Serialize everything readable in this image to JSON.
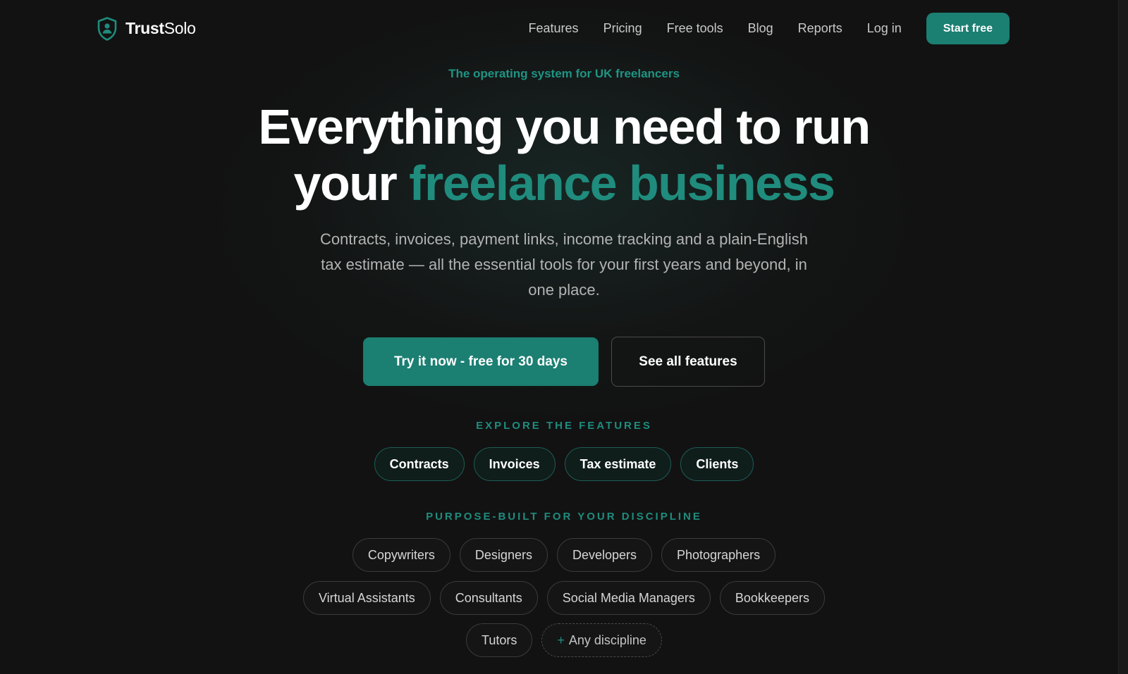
{
  "nav": {
    "brand_bold": "Trust",
    "brand_light": "Solo",
    "links": [
      "Features",
      "Pricing",
      "Free tools",
      "Blog",
      "Reports",
      "Log in"
    ],
    "cta": "Start free"
  },
  "hero": {
    "eyebrow": "The operating system for UK freelancers",
    "headline_line1": "Everything you need to run",
    "headline_line2_plain": "your ",
    "headline_line2_accent": "freelance business",
    "subtitle": "Contracts, invoices, payment links, income tracking and a plain-English tax estimate — all the essential tools for your first years and beyond, in one place.",
    "primary_cta": "Try it now - free for 30 days",
    "secondary_cta": "See all features"
  },
  "features": {
    "label": "EXPLORE THE FEATURES",
    "items": [
      "Contracts",
      "Invoices",
      "Tax estimate",
      "Clients"
    ]
  },
  "disciplines": {
    "label": "PURPOSE-BUILT FOR YOUR DISCIPLINE",
    "row1": [
      "Copywriters",
      "Designers",
      "Developers",
      "Photographers"
    ],
    "row2": [
      "Virtual Assistants",
      "Consultants",
      "Social Media Managers",
      "Bookkeepers"
    ],
    "row3": [
      "Tutors"
    ],
    "any_plus": "+",
    "any_label": "Any discipline"
  },
  "colors": {
    "accent": "#1b7f72",
    "background": "#121212"
  },
  "icons": {
    "brand": "shield-user-icon"
  }
}
